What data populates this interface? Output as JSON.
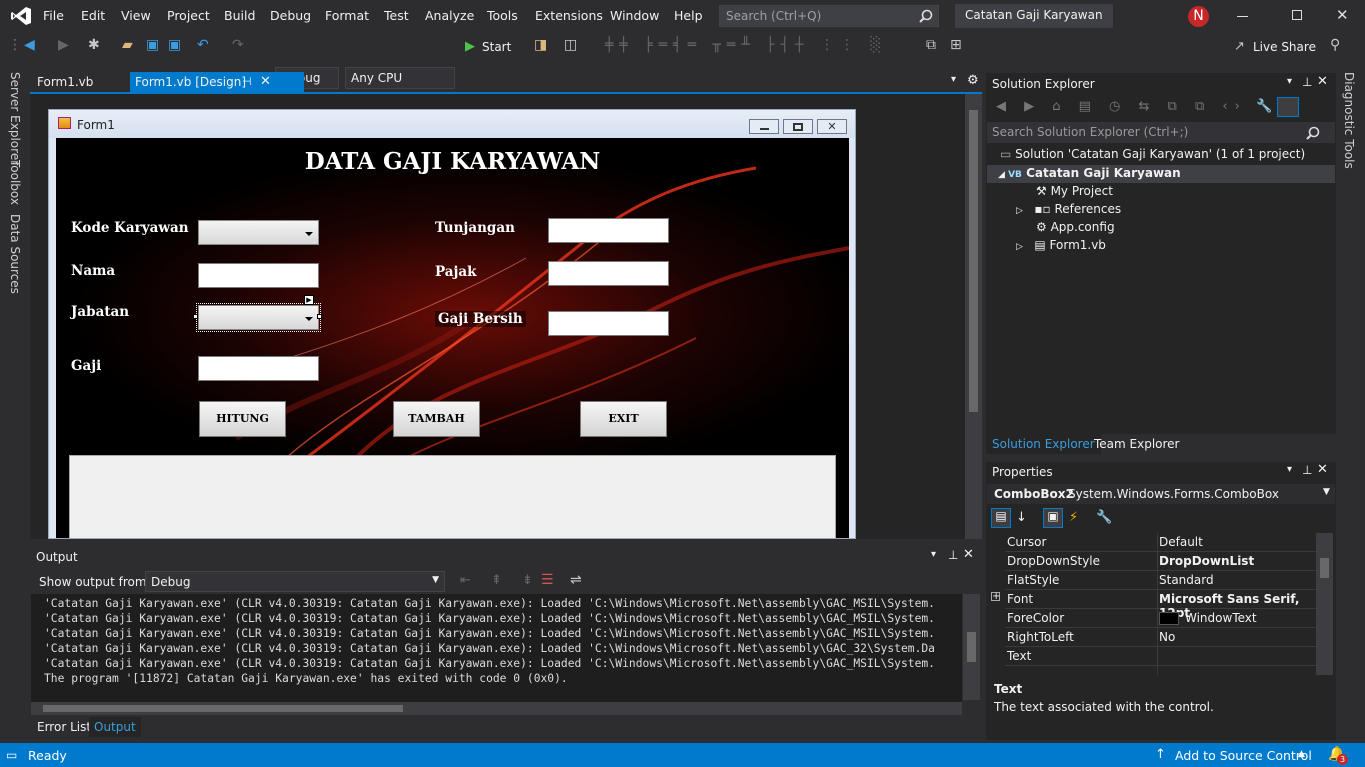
{
  "menu": [
    "File",
    "Edit",
    "View",
    "Project",
    "Build",
    "Debug",
    "Format",
    "Test",
    "Analyze",
    "Tools",
    "Extensions",
    "Window",
    "Help"
  ],
  "search_placeholder": "Search (Ctrl+Q)",
  "solution_title": "Catatan Gaji Karyawan",
  "user_initial": "N",
  "toolbar": {
    "config": "Debug",
    "platform": "Any CPU",
    "start": "Start",
    "live_share": "Live Share"
  },
  "doc_tabs": [
    {
      "label": "Form1.vb"
    },
    {
      "label": "Form1.vb [Design]"
    }
  ],
  "left_tabs": [
    "Server Explorer",
    "Toolbox",
    "Data Sources"
  ],
  "right_tab": "Diagnostic Tools",
  "form": {
    "caption": "Form1",
    "heading": "DATA GAJI KARYAWAN",
    "labels": {
      "kode": "Kode Karyawan",
      "nama": "Nama",
      "jabatan": "Jabatan",
      "gaji": "Gaji",
      "tunjangan": "Tunjangan",
      "pajak": "Pajak",
      "gaji_bersih": "Gaji Bersih"
    },
    "buttons": {
      "hitung": "HITUNG",
      "tambah": "TAMBAH",
      "exit": "EXIT"
    }
  },
  "output": {
    "title": "Output",
    "show_from_label": "Show output from:",
    "source": "Debug",
    "lines": [
      "'Catatan Gaji Karyawan.exe' (CLR v4.0.30319: Catatan Gaji Karyawan.exe): Loaded 'C:\\Windows\\Microsoft.Net\\assembly\\GAC_MSIL\\System.",
      "'Catatan Gaji Karyawan.exe' (CLR v4.0.30319: Catatan Gaji Karyawan.exe): Loaded 'C:\\Windows\\Microsoft.Net\\assembly\\GAC_MSIL\\System.",
      "'Catatan Gaji Karyawan.exe' (CLR v4.0.30319: Catatan Gaji Karyawan.exe): Loaded 'C:\\Windows\\Microsoft.Net\\assembly\\GAC_MSIL\\System.",
      "'Catatan Gaji Karyawan.exe' (CLR v4.0.30319: Catatan Gaji Karyawan.exe): Loaded 'C:\\Windows\\Microsoft.Net\\assembly\\GAC_32\\System.Da",
      "'Catatan Gaji Karyawan.exe' (CLR v4.0.30319: Catatan Gaji Karyawan.exe): Loaded 'C:\\Windows\\Microsoft.Net\\assembly\\GAC_MSIL\\System.",
      "The program '[11872] Catatan Gaji Karyawan.exe' has exited with code 0 (0x0)."
    ],
    "tabs": [
      "Error List",
      "Output"
    ]
  },
  "solution_explorer": {
    "title": "Solution Explorer",
    "search_placeholder": "Search Solution Explorer (Ctrl+;)",
    "solution": "Solution 'Catatan Gaji Karyawan' (1 of 1 project)",
    "project": "Catatan Gaji Karyawan",
    "items": [
      "My Project",
      "References",
      "App.config",
      "Form1.vb"
    ],
    "tabs": [
      "Solution Explorer",
      "Team Explorer"
    ]
  },
  "properties": {
    "title": "Properties",
    "object_name": "ComboBox2",
    "object_type": "System.Windows.Forms.ComboBox",
    "rows": [
      {
        "name": "Cursor",
        "value": "Default"
      },
      {
        "name": "DropDownStyle",
        "value": "DropDownList"
      },
      {
        "name": "FlatStyle",
        "value": "Standard"
      },
      {
        "name": "Font",
        "value": "Microsoft Sans Serif, 12pt"
      },
      {
        "name": "ForeColor",
        "value": "WindowText"
      },
      {
        "name": "RightToLeft",
        "value": "No"
      },
      {
        "name": "Text",
        "value": ""
      }
    ],
    "desc_title": "Text",
    "desc_text": "The text associated with the control."
  },
  "status": {
    "ready": "Ready",
    "source_control": "Add to Source Control",
    "notif_count": "3"
  },
  "colors": {
    "accent": "#007acc",
    "vs_purple": "#68217a",
    "user_badge": "#c62828"
  }
}
